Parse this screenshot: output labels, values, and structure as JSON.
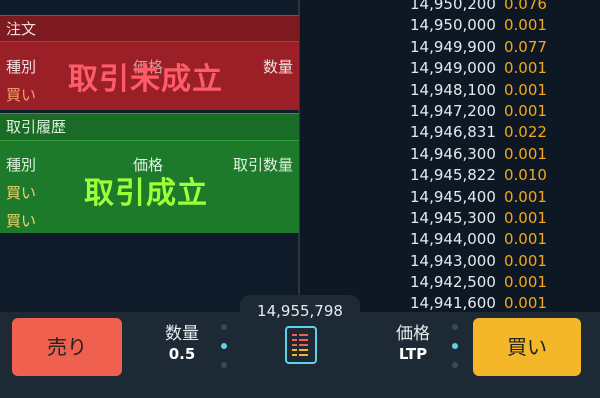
{
  "order_panel": {
    "title": "注文",
    "col_type": "種別",
    "col_price": "価格",
    "col_qty": "数量",
    "row_side": "買い",
    "overlay": "取引未成立"
  },
  "history_panel": {
    "title": "取引履歴",
    "col_type": "種別",
    "col_price": "価格",
    "col_qty": "取引数量",
    "rows": [
      "買い",
      "買い"
    ],
    "overlay": "取引成立"
  },
  "order_book": [
    {
      "price": "14,950,200",
      "qty": "0.076"
    },
    {
      "price": "14,950,000",
      "qty": "0.001"
    },
    {
      "price": "14,949,900",
      "qty": "0.077"
    },
    {
      "price": "14,949,000",
      "qty": "0.001"
    },
    {
      "price": "14,948,100",
      "qty": "0.001"
    },
    {
      "price": "14,947,200",
      "qty": "0.001"
    },
    {
      "price": "14,946,831",
      "qty": "0.022"
    },
    {
      "price": "14,946,300",
      "qty": "0.001"
    },
    {
      "price": "14,945,822",
      "qty": "0.010"
    },
    {
      "price": "14,945,400",
      "qty": "0.001"
    },
    {
      "price": "14,945,300",
      "qty": "0.001"
    },
    {
      "price": "14,944,000",
      "qty": "0.001"
    },
    {
      "price": "14,943,000",
      "qty": "0.001"
    },
    {
      "price": "14,942,500",
      "qty": "0.001"
    },
    {
      "price": "14,941,600",
      "qty": "0.001"
    }
  ],
  "bottom": {
    "ltp_price": "14,955,798",
    "sell_label": "売り",
    "buy_label": "買い",
    "qty_label": "数量",
    "qty_value": "0.5",
    "price_label": "価格",
    "price_value": "LTP"
  },
  "icons": {
    "order_book_toggle": "order-book-icon"
  },
  "colors": {
    "sell": "#f0604e",
    "buy": "#f5b72a",
    "ask_qty": "#f1a91b",
    "accent": "#5fd2e6"
  }
}
